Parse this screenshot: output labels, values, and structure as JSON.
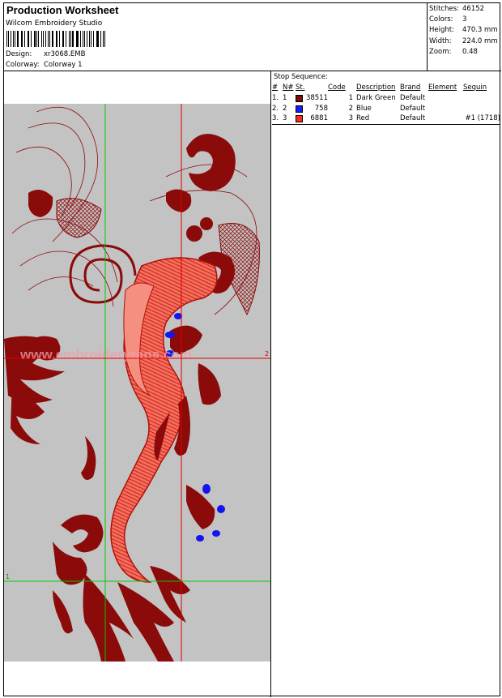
{
  "header": {
    "title": "Production Worksheet",
    "company": "Wilcom  Embroidery Studio",
    "design_label": "Design:",
    "design_value": "xr3068.EMB",
    "colorway_label": "Colorway:",
    "colorway_value": "Colorway 1"
  },
  "stats": [
    {
      "label": "Stitches:",
      "value": "46152"
    },
    {
      "label": "Colors:",
      "value": "3"
    },
    {
      "label": "Height:",
      "value": "470.3 mm"
    },
    {
      "label": "Width:",
      "value": "224.0 mm"
    },
    {
      "label": "Zoom:",
      "value": "0.48"
    }
  ],
  "stop_sequence": {
    "title": "Stop Sequence:",
    "columns": [
      "#",
      "N#",
      "St.",
      "Code",
      "Description",
      "Brand",
      "Element",
      "Sequin"
    ],
    "rows": [
      {
        "num": "1.",
        "n": "1",
        "color": "#7a0a0a",
        "stitches": "38511",
        "code": "1",
        "description": "Dark Green",
        "brand": "Default",
        "element": "",
        "sequin": ""
      },
      {
        "num": "2.",
        "n": "2",
        "color": "#1a1aff",
        "stitches": "758",
        "code": "2",
        "description": "Blue",
        "brand": "Default",
        "element": "",
        "sequin": ""
      },
      {
        "num": "3.",
        "n": "3",
        "color": "#ff2a1a",
        "stitches": "6881",
        "code": "3",
        "description": "Red",
        "brand": "Default",
        "element": "",
        "sequin": "#1 (1718)"
      }
    ]
  },
  "preview": {
    "guide_labels": [
      "1",
      "2"
    ],
    "watermark": "www.embroideryrans.com",
    "colors": {
      "dark_red": "#8b0a0a",
      "red": "#e8321e",
      "blue": "#1414f0",
      "canvas": "#c3c3c3",
      "guide_green": "#00c800",
      "guide_red": "#e00000"
    }
  }
}
